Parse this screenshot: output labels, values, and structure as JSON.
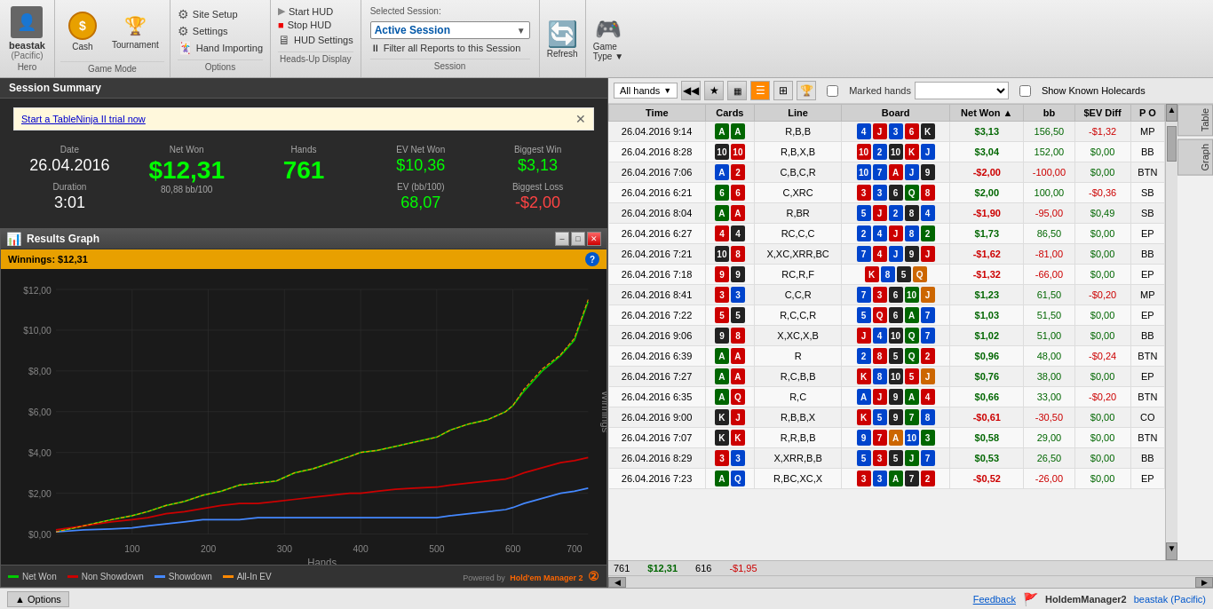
{
  "toolbar": {
    "hero": {
      "name": "beastak",
      "region": "(Pacific)",
      "label": "Hero"
    },
    "gamemode": {
      "cash_label": "Cash",
      "tournament_label": "Tournament",
      "section_label": "Game Mode"
    },
    "options": {
      "site_setup": "Site Setup",
      "settings": "Settings",
      "hand_importing": "Hand Importing",
      "section_label": "Options"
    },
    "hud": {
      "start_hud": "Start HUD",
      "stop_hud": "Stop HUD",
      "hud_settings": "HUD Settings",
      "section_label": "Heads-Up Display"
    },
    "session": {
      "label": "Selected Session:",
      "active": "Active Session",
      "filter": "Filter all Reports to this Session",
      "section_label": "Session"
    },
    "refresh": {
      "label": "Refresh"
    },
    "gametype": {
      "label": "Game\nType"
    }
  },
  "session_summary": {
    "title": "Session Summary",
    "notification": "Start a TableNinja II trial now",
    "date_label": "Date",
    "date_value": "26.04.2016",
    "net_won_label": "Net Won",
    "net_won_value": "$12,31",
    "net_won_sub": "80,88 bb/100",
    "hands_label": "Hands",
    "hands_value": "761",
    "ev_net_won_label": "EV Net Won",
    "ev_net_won_value": "$10,36",
    "biggest_win_label": "Biggest Win",
    "biggest_win_value": "$3,13",
    "duration_label": "Duration",
    "duration_value": "3:01",
    "ev_bb100_label": "EV (bb/100)",
    "ev_bb100_value": "68,07",
    "biggest_loss_label": "Biggest Loss",
    "biggest_loss_value": "-$2,00"
  },
  "graph": {
    "title": "Results Graph",
    "winnings": "Winnings: $12,31",
    "y_labels": [
      "$12,00",
      "$10,00",
      "$8,00",
      "$6,00",
      "$4,00",
      "$2,00",
      "$0,00"
    ],
    "x_labels": [
      "100",
      "200",
      "300",
      "400",
      "500",
      "600",
      "700"
    ],
    "x_axis_label": "Hands",
    "legend": {
      "net_won": "Net Won",
      "non_showdown": "Non Showdown",
      "showdown": "Showdown",
      "allin_ev": "All-In EV"
    },
    "branding": "Powered by",
    "app_name": "Hold'em Manager 2"
  },
  "hands_table": {
    "filter_label": "All hands",
    "marked_hands_label": "Marked hands",
    "show_holecards_label": "Show Known Holecards",
    "columns": [
      "Time",
      "Cards",
      "Line",
      "Board",
      "Net Won",
      "bb",
      "$EV Diff",
      "P O"
    ],
    "rows": [
      {
        "time": "26.04.2016 9:14",
        "cards": [
          {
            "v": "A",
            "c": "green"
          },
          {
            "v": "A",
            "c": "green"
          }
        ],
        "line": "R,B,B",
        "board": [
          {
            "v": "4",
            "c": "blue"
          },
          {
            "v": "J",
            "c": "red"
          },
          {
            "v": "3",
            "c": "blue"
          },
          {
            "v": "6",
            "c": "red"
          },
          {
            "v": "K",
            "c": "black"
          }
        ],
        "net_won": "$3,13",
        "bb": "156,50",
        "ev_diff": "-$1,32",
        "pos": "MP"
      },
      {
        "time": "26.04.2016 8:28",
        "cards": [
          {
            "v": "10",
            "c": "black"
          },
          {
            "v": "10",
            "c": "red"
          }
        ],
        "line": "R,B,X,B",
        "board": [
          {
            "v": "10",
            "c": "red"
          },
          {
            "v": "2",
            "c": "blue"
          },
          {
            "v": "10",
            "c": "black"
          },
          {
            "v": "K",
            "c": "red"
          },
          {
            "v": "J",
            "c": "blue"
          }
        ],
        "net_won": "$3,04",
        "bb": "152,00",
        "ev_diff": "$0,00",
        "pos": "BB"
      },
      {
        "time": "26.04.2016 7:06",
        "cards": [
          {
            "v": "A",
            "c": "blue"
          },
          {
            "v": "2",
            "c": "red"
          }
        ],
        "line": "C,B,C,R",
        "board": [
          {
            "v": "10",
            "c": "blue"
          },
          {
            "v": "7",
            "c": "blue"
          },
          {
            "v": "A",
            "c": "red"
          },
          {
            "v": "J",
            "c": "blue"
          },
          {
            "v": "9",
            "c": "black"
          }
        ],
        "net_won": "-$2,00",
        "bb": "-100,00",
        "ev_diff": "$0,00",
        "pos": "BTN"
      },
      {
        "time": "26.04.2016 6:21",
        "cards": [
          {
            "v": "6",
            "c": "green"
          },
          {
            "v": "6",
            "c": "red"
          }
        ],
        "line": "C,XRC",
        "board": [
          {
            "v": "3",
            "c": "red"
          },
          {
            "v": "3",
            "c": "blue"
          },
          {
            "v": "6",
            "c": "black"
          },
          {
            "v": "Q",
            "c": "green"
          },
          {
            "v": "8",
            "c": "red"
          }
        ],
        "net_won": "$2,00",
        "bb": "100,00",
        "ev_diff": "-$0,36",
        "pos": "SB"
      },
      {
        "time": "26.04.2016 8:04",
        "cards": [
          {
            "v": "A",
            "c": "green"
          },
          {
            "v": "A",
            "c": "red"
          }
        ],
        "line": "R,BR",
        "board": [
          {
            "v": "5",
            "c": "blue"
          },
          {
            "v": "J",
            "c": "red"
          },
          {
            "v": "2",
            "c": "blue"
          },
          {
            "v": "8",
            "c": "black"
          },
          {
            "v": "4",
            "c": "blue"
          }
        ],
        "net_won": "-$1,90",
        "bb": "-95,00",
        "ev_diff": "$0,49",
        "pos": "SB"
      },
      {
        "time": "26.04.2016 6:27",
        "cards": [
          {
            "v": "4",
            "c": "red"
          },
          {
            "v": "4",
            "c": "black"
          }
        ],
        "line": "RC,C,C",
        "board": [
          {
            "v": "2",
            "c": "blue"
          },
          {
            "v": "4",
            "c": "blue"
          },
          {
            "v": "J",
            "c": "red"
          },
          {
            "v": "8",
            "c": "blue"
          },
          {
            "v": "2",
            "c": "green"
          }
        ],
        "net_won": "$1,73",
        "bb": "86,50",
        "ev_diff": "$0,00",
        "pos": "EP"
      },
      {
        "time": "26.04.2016 7:21",
        "cards": [
          {
            "v": "10",
            "c": "black"
          },
          {
            "v": "8",
            "c": "red"
          }
        ],
        "line": "X,XC,XRR,BC",
        "board": [
          {
            "v": "7",
            "c": "blue"
          },
          {
            "v": "4",
            "c": "red"
          },
          {
            "v": "J",
            "c": "blue"
          },
          {
            "v": "9",
            "c": "black"
          },
          {
            "v": "J",
            "c": "red"
          }
        ],
        "net_won": "-$1,62",
        "bb": "-81,00",
        "ev_diff": "$0,00",
        "pos": "BB"
      },
      {
        "time": "26.04.2016 7:18",
        "cards": [
          {
            "v": "9",
            "c": "red"
          },
          {
            "v": "9",
            "c": "black"
          }
        ],
        "line": "RC,R,F",
        "board": [
          {
            "v": "K",
            "c": "red"
          },
          {
            "v": "8",
            "c": "blue"
          },
          {
            "v": "5",
            "c": "black"
          },
          {
            "v": "Q",
            "c": "orange"
          }
        ],
        "net_won": "-$1,32",
        "bb": "-66,00",
        "ev_diff": "$0,00",
        "pos": "EP"
      },
      {
        "time": "26.04.2016 8:41",
        "cards": [
          {
            "v": "3",
            "c": "red"
          },
          {
            "v": "3",
            "c": "blue"
          }
        ],
        "line": "C,C,R",
        "board": [
          {
            "v": "7",
            "c": "blue"
          },
          {
            "v": "3",
            "c": "red"
          },
          {
            "v": "6",
            "c": "black"
          },
          {
            "v": "10",
            "c": "green"
          },
          {
            "v": "J",
            "c": "orange"
          }
        ],
        "net_won": "$1,23",
        "bb": "61,50",
        "ev_diff": "-$0,20",
        "pos": "MP"
      },
      {
        "time": "26.04.2016 7:22",
        "cards": [
          {
            "v": "5",
            "c": "red"
          },
          {
            "v": "5",
            "c": "black"
          }
        ],
        "line": "R,C,C,R",
        "board": [
          {
            "v": "5",
            "c": "blue"
          },
          {
            "v": "Q",
            "c": "red"
          },
          {
            "v": "6",
            "c": "black"
          },
          {
            "v": "A",
            "c": "green"
          },
          {
            "v": "7",
            "c": "blue"
          }
        ],
        "net_won": "$1,03",
        "bb": "51,50",
        "ev_diff": "$0,00",
        "pos": "EP"
      },
      {
        "time": "26.04.2016 9:06",
        "cards": [
          {
            "v": "9",
            "c": "black"
          },
          {
            "v": "8",
            "c": "red"
          }
        ],
        "line": "X,XC,X,B",
        "board": [
          {
            "v": "J",
            "c": "red"
          },
          {
            "v": "4",
            "c": "blue"
          },
          {
            "v": "10",
            "c": "black"
          },
          {
            "v": "Q",
            "c": "green"
          },
          {
            "v": "7",
            "c": "blue"
          }
        ],
        "net_won": "$1,02",
        "bb": "51,00",
        "ev_diff": "$0,00",
        "pos": "BB"
      },
      {
        "time": "26.04.2016 6:39",
        "cards": [
          {
            "v": "A",
            "c": "green"
          },
          {
            "v": "A",
            "c": "red"
          }
        ],
        "line": "R",
        "board": [
          {
            "v": "2",
            "c": "blue"
          },
          {
            "v": "8",
            "c": "red"
          },
          {
            "v": "5",
            "c": "black"
          },
          {
            "v": "Q",
            "c": "green"
          },
          {
            "v": "2",
            "c": "red"
          }
        ],
        "net_won": "$0,96",
        "bb": "48,00",
        "ev_diff": "-$0,24",
        "pos": "BTN"
      },
      {
        "time": "26.04.2016 7:27",
        "cards": [
          {
            "v": "A",
            "c": "green"
          },
          {
            "v": "A",
            "c": "red"
          }
        ],
        "line": "R,C,B,B",
        "board": [
          {
            "v": "K",
            "c": "red"
          },
          {
            "v": "8",
            "c": "blue"
          },
          {
            "v": "10",
            "c": "black"
          },
          {
            "v": "5",
            "c": "red"
          },
          {
            "v": "J",
            "c": "orange"
          }
        ],
        "net_won": "$0,76",
        "bb": "38,00",
        "ev_diff": "$0,00",
        "pos": "EP"
      },
      {
        "time": "26.04.2016 6:35",
        "cards": [
          {
            "v": "A",
            "c": "green"
          },
          {
            "v": "Q",
            "c": "red"
          }
        ],
        "line": "R,C",
        "board": [
          {
            "v": "A",
            "c": "blue"
          },
          {
            "v": "J",
            "c": "red"
          },
          {
            "v": "9",
            "c": "black"
          },
          {
            "v": "A",
            "c": "green"
          },
          {
            "v": "4",
            "c": "red"
          }
        ],
        "net_won": "$0,66",
        "bb": "33,00",
        "ev_diff": "-$0,20",
        "pos": "BTN"
      },
      {
        "time": "26.04.2016 9:00",
        "cards": [
          {
            "v": "K",
            "c": "black"
          },
          {
            "v": "J",
            "c": "red"
          }
        ],
        "line": "R,B,B,X",
        "board": [
          {
            "v": "K",
            "c": "red"
          },
          {
            "v": "5",
            "c": "blue"
          },
          {
            "v": "9",
            "c": "black"
          },
          {
            "v": "7",
            "c": "green"
          },
          {
            "v": "8",
            "c": "blue"
          }
        ],
        "net_won": "-$0,61",
        "bb": "-30,50",
        "ev_diff": "$0,00",
        "pos": "CO"
      },
      {
        "time": "26.04.2016 7:07",
        "cards": [
          {
            "v": "K",
            "c": "black"
          },
          {
            "v": "K",
            "c": "red"
          }
        ],
        "line": "R,R,B,B",
        "board": [
          {
            "v": "9",
            "c": "blue"
          },
          {
            "v": "7",
            "c": "red"
          },
          {
            "v": "A",
            "c": "orange"
          },
          {
            "v": "10",
            "c": "blue"
          },
          {
            "v": "3",
            "c": "green"
          }
        ],
        "net_won": "$0,58",
        "bb": "29,00",
        "ev_diff": "$0,00",
        "pos": "BTN"
      },
      {
        "time": "26.04.2016 8:29",
        "cards": [
          {
            "v": "3",
            "c": "red"
          },
          {
            "v": "3",
            "c": "blue"
          }
        ],
        "line": "X,XRR,B,B",
        "board": [
          {
            "v": "5",
            "c": "blue"
          },
          {
            "v": "3",
            "c": "red"
          },
          {
            "v": "5",
            "c": "black"
          },
          {
            "v": "J",
            "c": "green"
          },
          {
            "v": "7",
            "c": "blue"
          }
        ],
        "net_won": "$0,53",
        "bb": "26,50",
        "ev_diff": "$0,00",
        "pos": "BB"
      },
      {
        "time": "26.04.2016 7:23",
        "cards": [
          {
            "v": "A",
            "c": "green"
          },
          {
            "v": "Q",
            "c": "blue"
          }
        ],
        "line": "R,BC,XC,X",
        "board": [
          {
            "v": "3",
            "c": "red"
          },
          {
            "v": "3",
            "c": "blue"
          },
          {
            "v": "A",
            "c": "green"
          },
          {
            "v": "7",
            "c": "black"
          },
          {
            "v": "2",
            "c": "red"
          }
        ],
        "net_won": "-$0,52",
        "bb": "-26,00",
        "ev_diff": "$0,00",
        "pos": "EP"
      }
    ],
    "footer": {
      "count": "761",
      "net_won": "$12,31",
      "bb": "616",
      "ev_diff": "-$1,95"
    }
  },
  "status_bar": {
    "settings_label": "Options",
    "feedback_label": "Feedback",
    "app_name": "HoldemManager2",
    "user": "beastak (Pacific)"
  }
}
